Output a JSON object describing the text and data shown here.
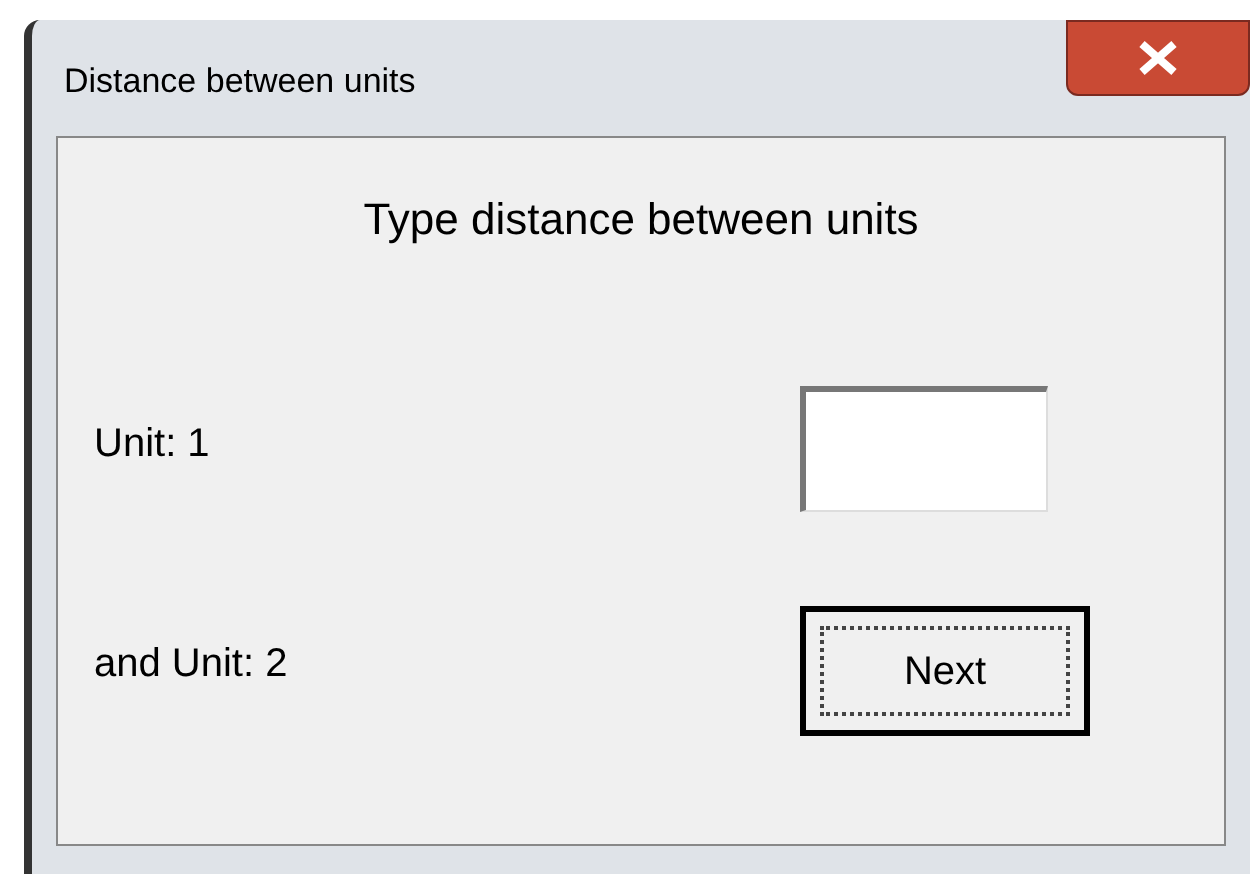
{
  "window": {
    "title": "Distance between units"
  },
  "heading": "Type distance between units",
  "rows": [
    {
      "label": "Unit: 1",
      "kind": "field",
      "value": ""
    },
    {
      "label": "and Unit: 2",
      "kind": "button",
      "button": "Next",
      "focused": true
    }
  ]
}
